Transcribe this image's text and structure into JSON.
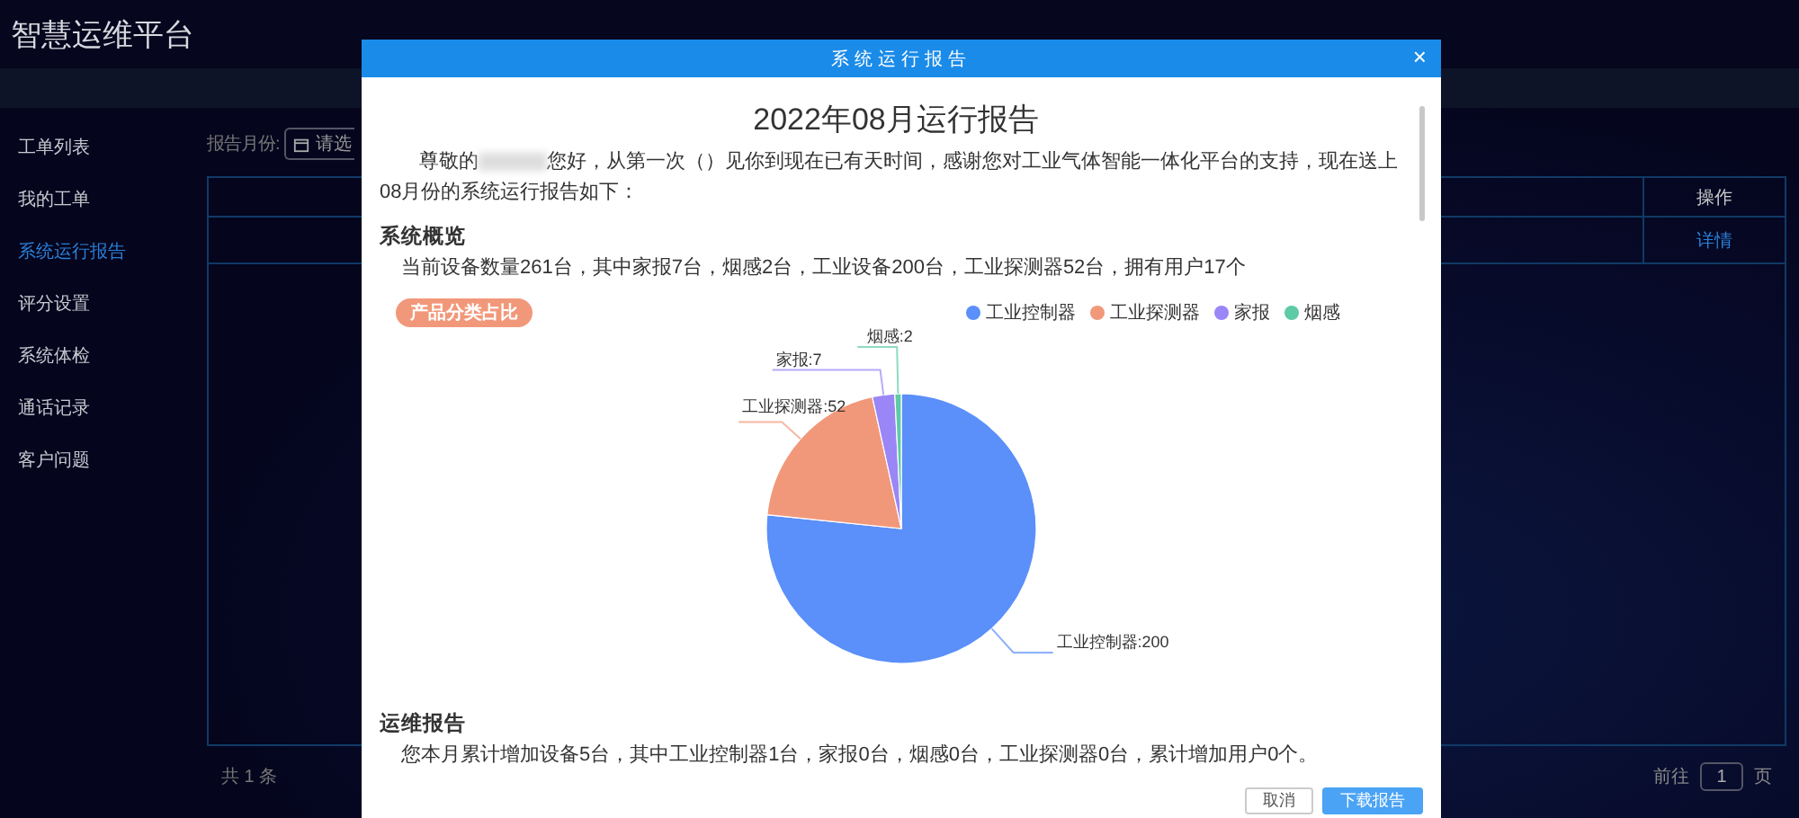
{
  "app": {
    "title": "智慧运维平台"
  },
  "sidebar": {
    "items": [
      {
        "label": "工单列表",
        "selected": false
      },
      {
        "label": "我的工单",
        "selected": false
      },
      {
        "label": "系统运行报告",
        "selected": true
      },
      {
        "label": "评分设置",
        "selected": false
      },
      {
        "label": "系统体检",
        "selected": false
      },
      {
        "label": "通话记录",
        "selected": false
      },
      {
        "label": "客户问题",
        "selected": false
      }
    ]
  },
  "filter": {
    "label": "报告月份:",
    "placeholder": "请选"
  },
  "table": {
    "columns": [
      {
        "label": "操作"
      }
    ],
    "rows": [
      {
        "action": "详情"
      }
    ]
  },
  "pagination": {
    "total": "共 1 条",
    "goto_label": "前往",
    "page": "1",
    "page_suffix": "页"
  },
  "modal": {
    "title": "系统运行报告",
    "close": "×",
    "heading": "2022年08月运行报告",
    "intro_before": "尊敬的",
    "intro_after": "您好，从第一次（）见你到现在已有天时间，感谢您对工业气体智能一体化平台的支持，现在送上08月份的系统运行报告如下：",
    "sections": [
      {
        "title": "系统概览",
        "text": "当前设备数量261台，其中家报7台，烟感2台，工业设备200台，工业探测器52台，拥有用户17个",
        "chart": {
          "legend": [
            {
              "color": "#5b8ff9"
            },
            {
              "color": "#f2987a"
            },
            {
              "color": "#9a86f6"
            },
            {
              "color": "#5ecaa6"
            }
          ],
          "chart_data": {
            "type": "pie",
            "title": "产品分类占比",
            "categories": [
              "工业控制器",
              "工业探测器",
              "家报",
              "烟感"
            ],
            "values": [
              200,
              52,
              7,
              2
            ],
            "value_labels": [
              "工业控制器:200",
              "工业探测器:52",
              "家报:7",
              "烟感:2"
            ]
          }
        }
      },
      {
        "title": "运维报告",
        "text": "您本月累计增加设备5台，其中工业控制器1台，家报0台，烟感0台，工业探测器0台，累计增加用户0个。"
      }
    ],
    "buttons": [
      {
        "label": "取消",
        "kind": "plain"
      },
      {
        "label": "下载报告",
        "kind": "primary"
      }
    ]
  }
}
